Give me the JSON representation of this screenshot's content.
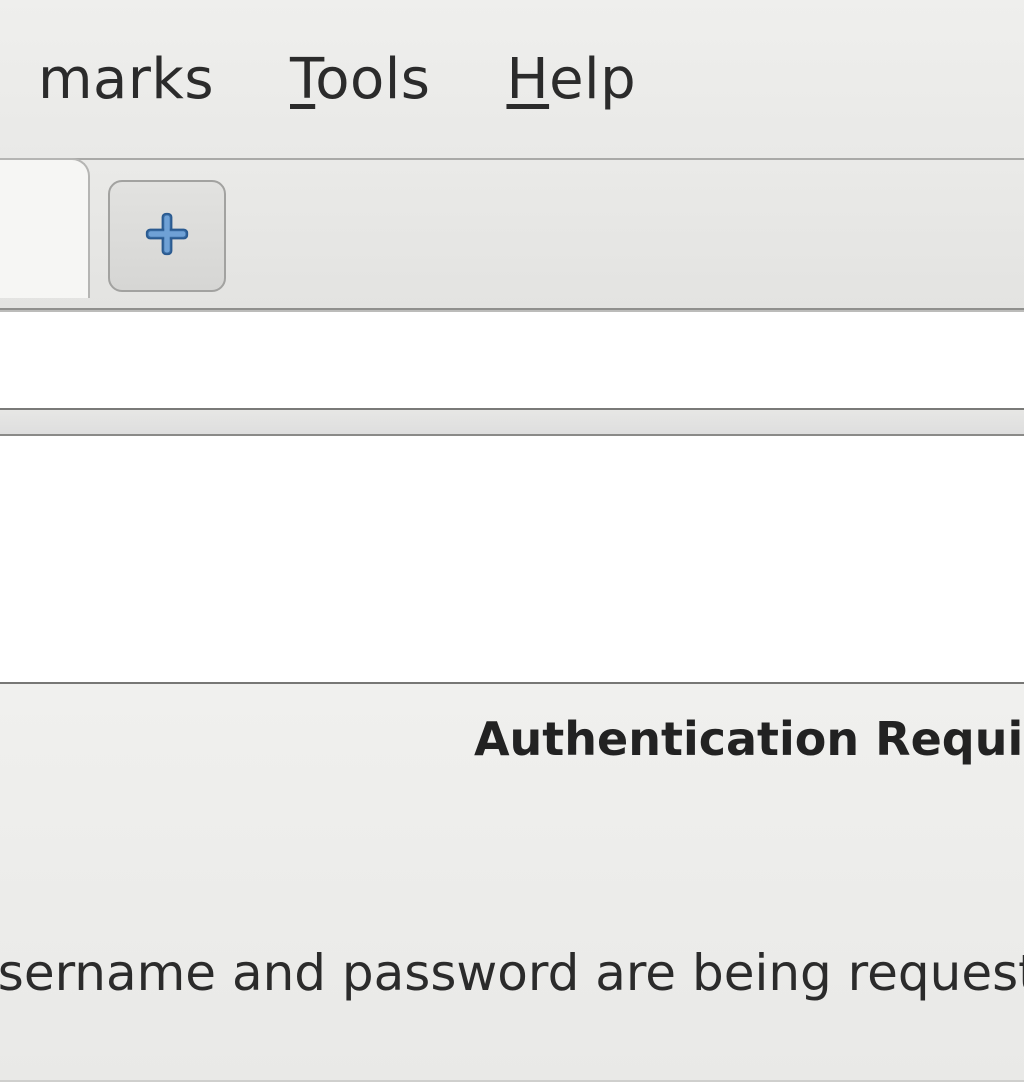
{
  "menubar": {
    "items": [
      {
        "label_prefix": "",
        "label_mnemonic": "",
        "label_suffix": "marks"
      },
      {
        "label_prefix": "",
        "label_mnemonic": "T",
        "label_suffix": "ools"
      },
      {
        "label_prefix": "",
        "label_mnemonic": "H",
        "label_suffix": "elp"
      }
    ]
  },
  "tabs": {
    "newtab_icon": "plus-icon"
  },
  "dialog": {
    "title": "Authentication Required",
    "body": "A username and password are being requested by"
  }
}
